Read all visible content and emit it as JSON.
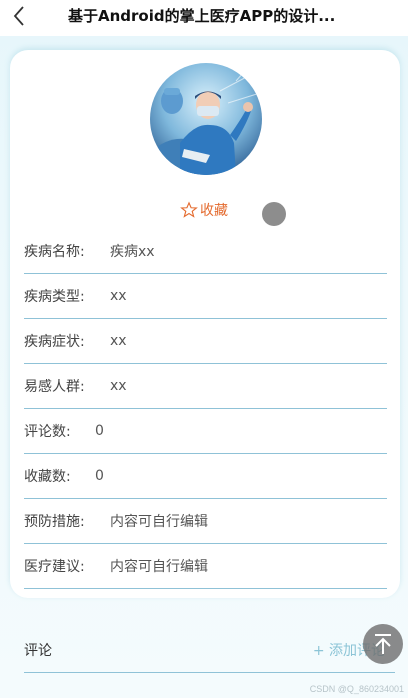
{
  "header": {
    "title": "基于Android的掌上医疗APP的设计..."
  },
  "favorite": {
    "label": "收藏"
  },
  "details": [
    {
      "label": "疾病名称:",
      "value": "疾病xx"
    },
    {
      "label": "疾病类型:",
      "value": "xx"
    },
    {
      "label": "疾病症状:",
      "value": "xx"
    },
    {
      "label": "易感人群:",
      "value": "xx"
    },
    {
      "label": "评论数:",
      "value": "0"
    },
    {
      "label": "收藏数:",
      "value": "0"
    },
    {
      "label": "预防措施:",
      "value": "内容可自行编辑"
    },
    {
      "label": "医疗建议:",
      "value": "内容可自行编辑"
    }
  ],
  "comments": {
    "title": "评论",
    "add_label": "+ 添加评论"
  },
  "watermark": "CSDN @Q_860234001",
  "colors": {
    "accent": "#e46b2f",
    "divider": "#8fc2d7",
    "link": "#8bc4d6"
  }
}
